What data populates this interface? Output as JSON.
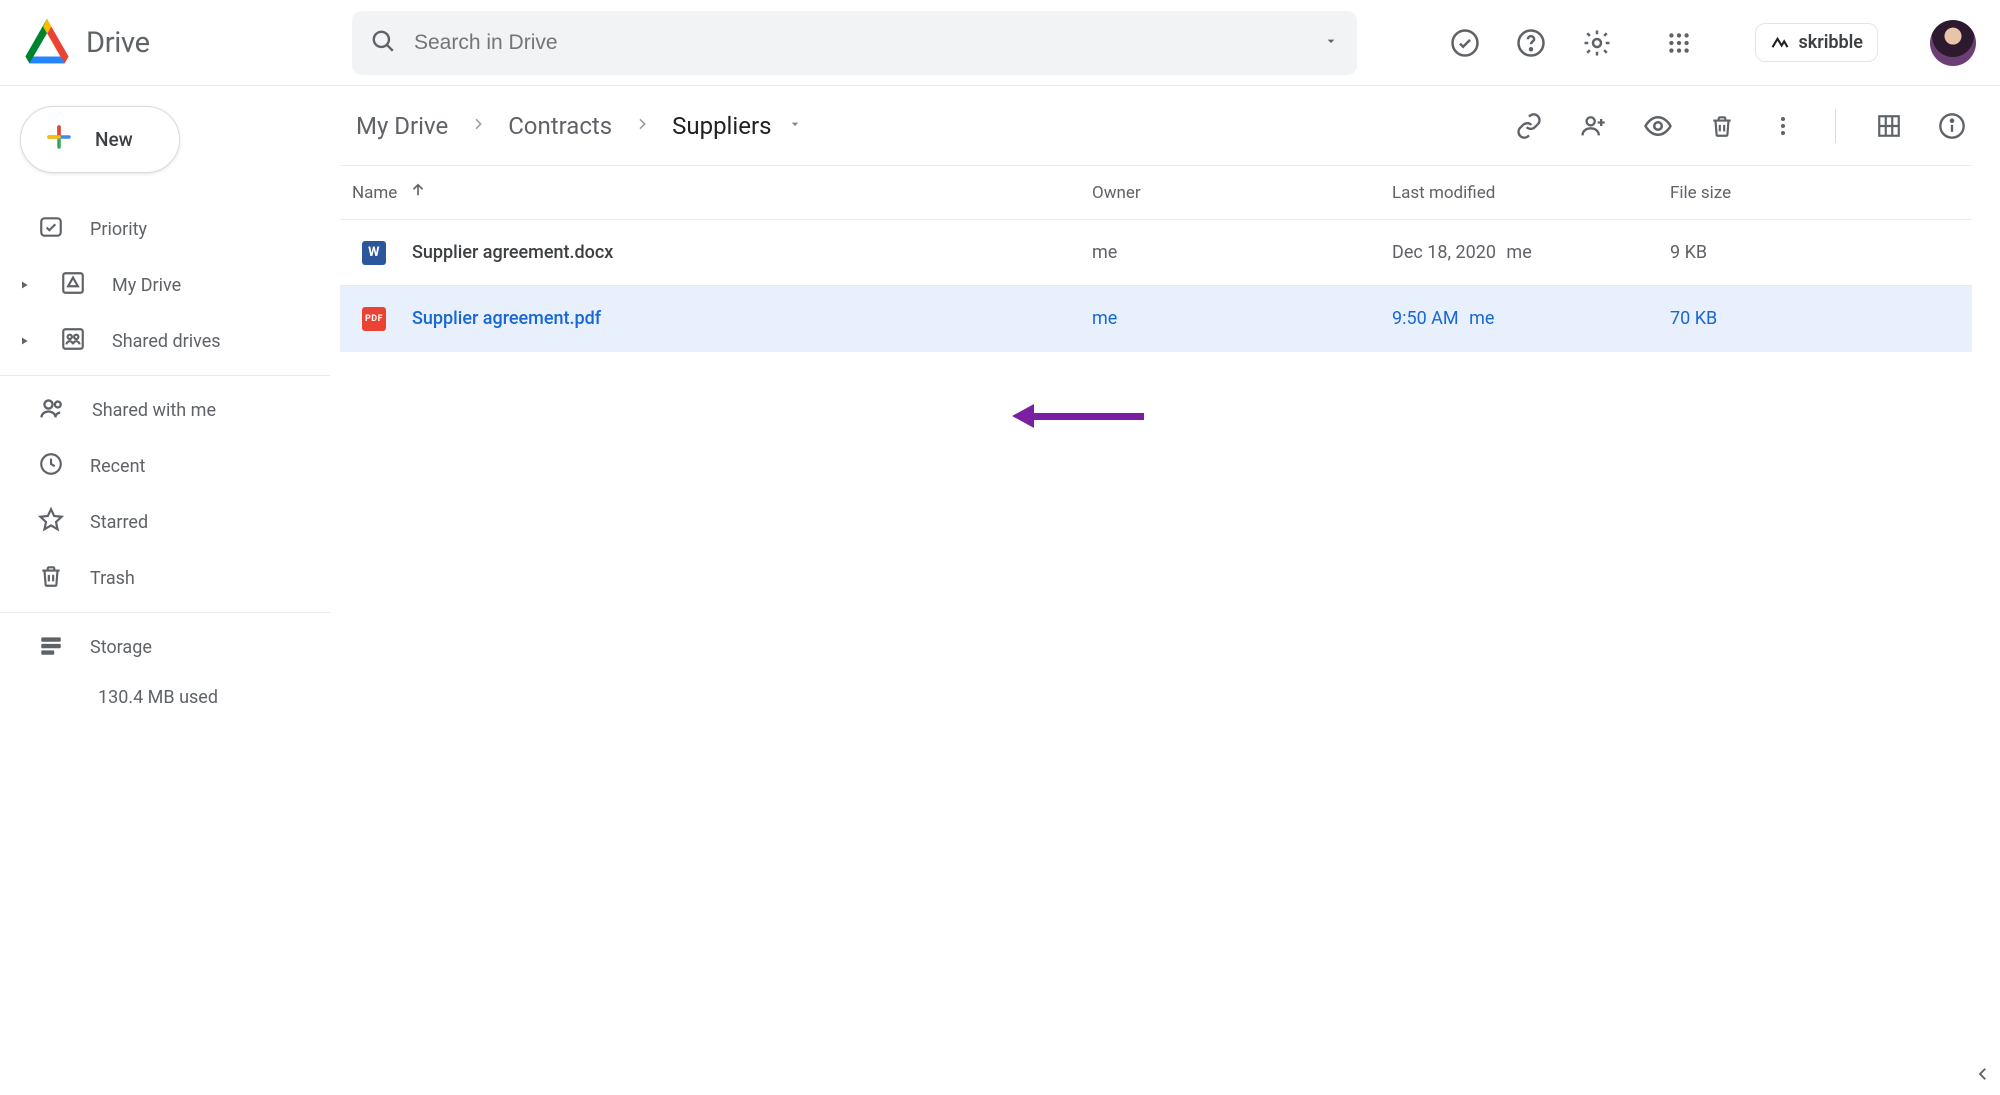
{
  "app_name": "Drive",
  "search": {
    "placeholder": "Search in Drive"
  },
  "brand_chip": "skribble",
  "sidebar": {
    "new_label": "New",
    "items": [
      {
        "label": "Priority"
      },
      {
        "label": "My Drive"
      },
      {
        "label": "Shared drives"
      }
    ],
    "items2": [
      {
        "label": "Shared with me"
      },
      {
        "label": "Recent"
      },
      {
        "label": "Starred"
      },
      {
        "label": "Trash"
      }
    ],
    "storage_label": "Storage",
    "storage_used": "130.4 MB used"
  },
  "breadcrumbs": [
    "My Drive",
    "Contracts",
    "Suppliers"
  ],
  "columns": {
    "name": "Name",
    "owner": "Owner",
    "modified": "Last modified",
    "size": "File size"
  },
  "files": [
    {
      "name": "Supplier agreement.docx",
      "type": "word",
      "type_badge": "W",
      "owner": "me",
      "modified": "Dec 18, 2020",
      "modified_by": "me",
      "size": "9 KB",
      "selected": false
    },
    {
      "name": "Supplier agreement.pdf",
      "type": "pdf",
      "type_badge": "PDF",
      "owner": "me",
      "modified": "9:50 AM",
      "modified_by": "me",
      "size": "70 KB",
      "selected": true
    }
  ]
}
